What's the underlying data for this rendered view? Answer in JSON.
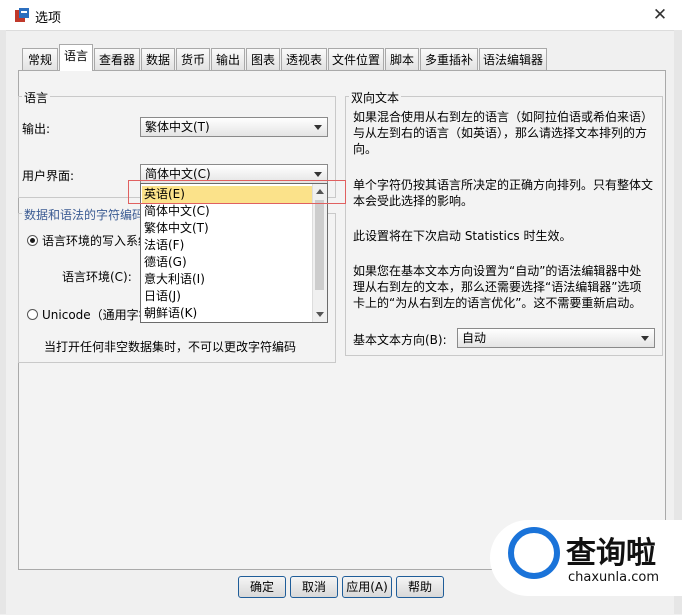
{
  "window": {
    "title": "选项",
    "close_glyph": "✕"
  },
  "tabs": [
    {
      "label": "常规",
      "active": false
    },
    {
      "label": "语言",
      "active": true
    },
    {
      "label": "查看器",
      "active": false
    },
    {
      "label": "数据",
      "active": false
    },
    {
      "label": "货币",
      "active": false
    },
    {
      "label": "输出",
      "active": false
    },
    {
      "label": "图表",
      "active": false
    },
    {
      "label": "透视表",
      "active": false
    },
    {
      "label": "文件位置",
      "active": false
    },
    {
      "label": "脚本",
      "active": false
    },
    {
      "label": "多重插补",
      "active": false
    },
    {
      "label": "语法编辑器",
      "active": false
    }
  ],
  "language_group": {
    "legend": "语言",
    "output_label": "输出:",
    "output_value": "繁体中文(T)",
    "ui_label": "用户界面:",
    "ui_value": "简体中文(C)"
  },
  "dropdown": {
    "options": [
      "英语(E)",
      "简体中文(C)",
      "繁体中文(T)",
      "法语(F)",
      "德语(G)",
      "意大利语(I)",
      "日语(J)",
      "朝鲜语(K)"
    ],
    "selected_index": 0
  },
  "encoding_group": {
    "legend": "数据和语法的字符编码",
    "radio_locale": "语言环境的写入系统",
    "locale_label": "语言环境(C):",
    "radio_unicode": "Unicode（通用字符",
    "note": "当打开任何非空数据集时，不可以更改字符编码"
  },
  "bidi_group": {
    "legend": "双向文本",
    "para1": "如果混合使用从右到左的语言（如阿拉伯语或希伯来语）与从左到右的语言（如英语），那么请选择文本排列的方向。",
    "para2": "单个字符仍按其语言所决定的正确方向排列。只有整体文本会受此选择的影响。",
    "para3": "此设置将在下次启动 Statistics 时生效。",
    "para4": "如果您在基本文本方向设置为“自动”的语法编辑器中处理从右到左的文本，那么还需要选择“语法编辑器”选项卡上的“为从右到左的语言优化”。这不需要重新启动。",
    "dir_label": "基本文本方向(B):",
    "dir_value": "自动"
  },
  "buttons": {
    "ok": "确定",
    "cancel": "取消",
    "apply": "应用(A)",
    "help": "帮助"
  },
  "watermark": {
    "text": "查询啦",
    "sub": "chaxunla.com"
  },
  "colors": {
    "accent": "#1f5d99",
    "highlight": "#fbe28a",
    "annotation": "#e06060"
  }
}
